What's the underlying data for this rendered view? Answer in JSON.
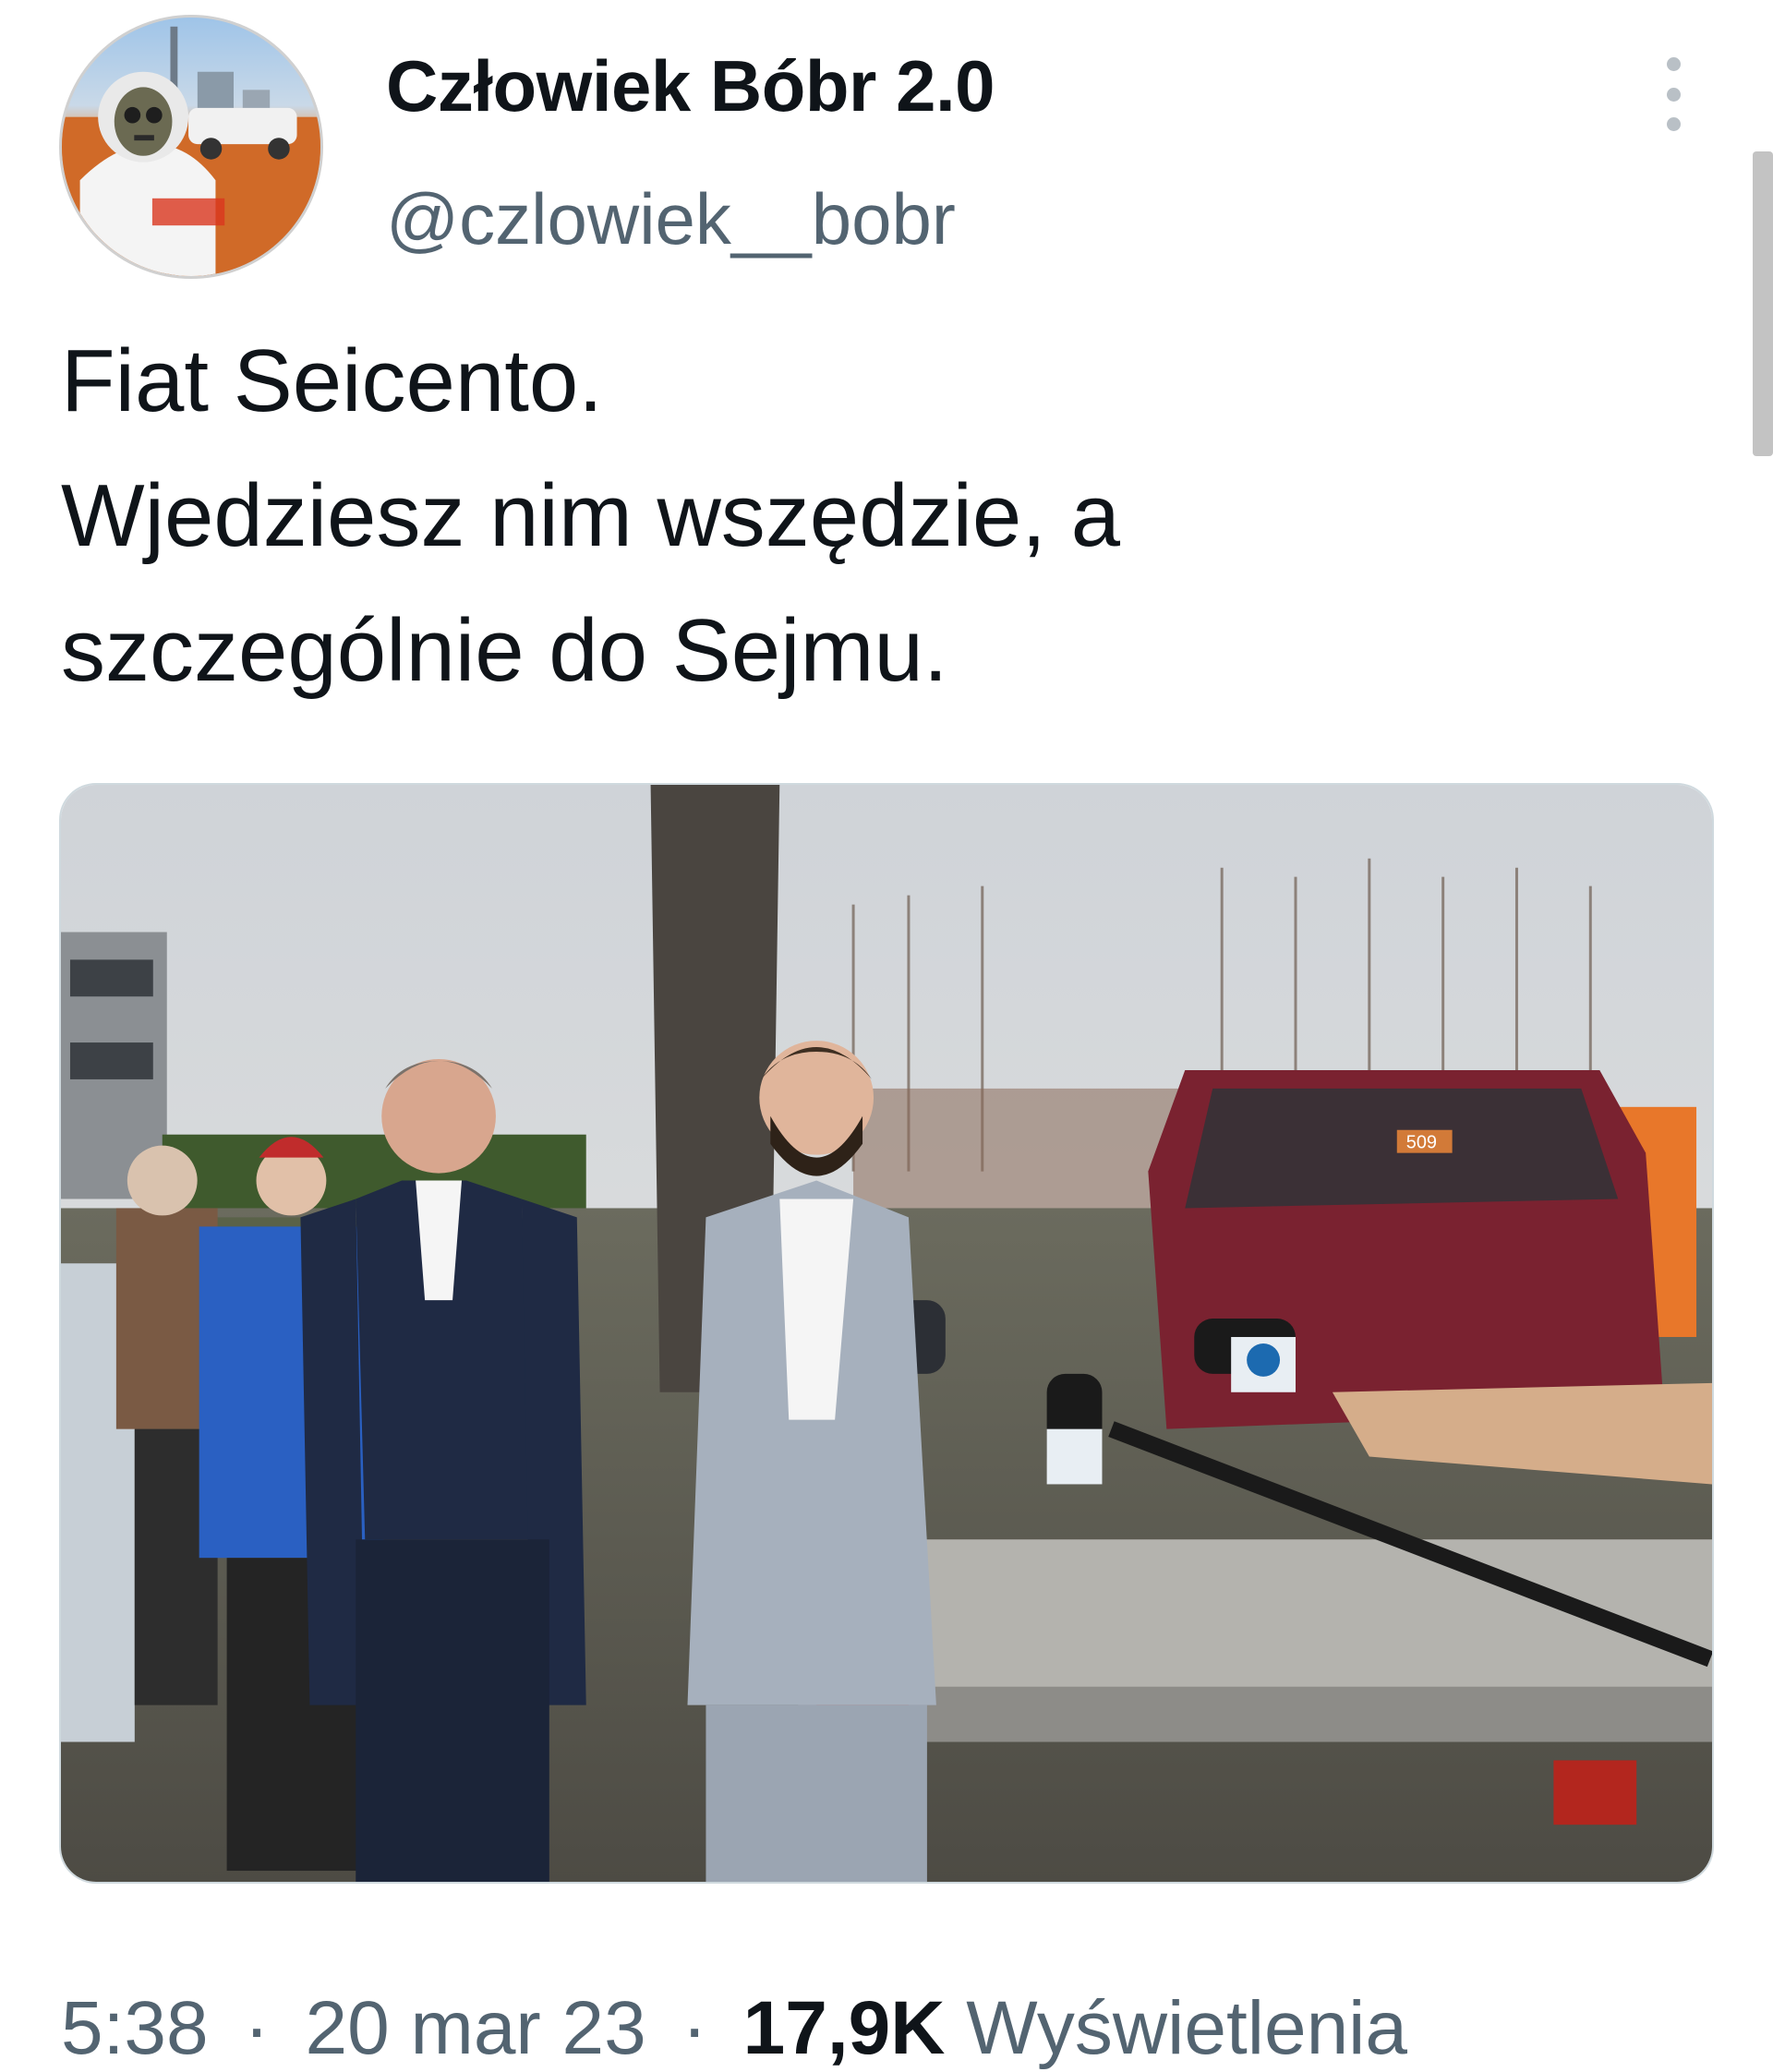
{
  "author": {
    "display_name": "Człowiek Bóbr 2.0",
    "handle": "@czlowiek__bobr",
    "avatar_icon": "user-avatar"
  },
  "tweet": {
    "lines": [
      "Fiat Seicento.",
      "Wjedziesz nim wszędzie, a",
      "szczególnie do Sejmu."
    ]
  },
  "media": {
    "plate_text": "509"
  },
  "meta": {
    "time": "5:38",
    "separator": "·",
    "date": "20 mar 23",
    "views_count": "17,9K",
    "views_label": "Wyświetlenia"
  },
  "more_icon": "more-vertical-icon",
  "colors": {
    "text": "#0f1419",
    "secondary": "#536471",
    "border": "#cfd9de"
  }
}
